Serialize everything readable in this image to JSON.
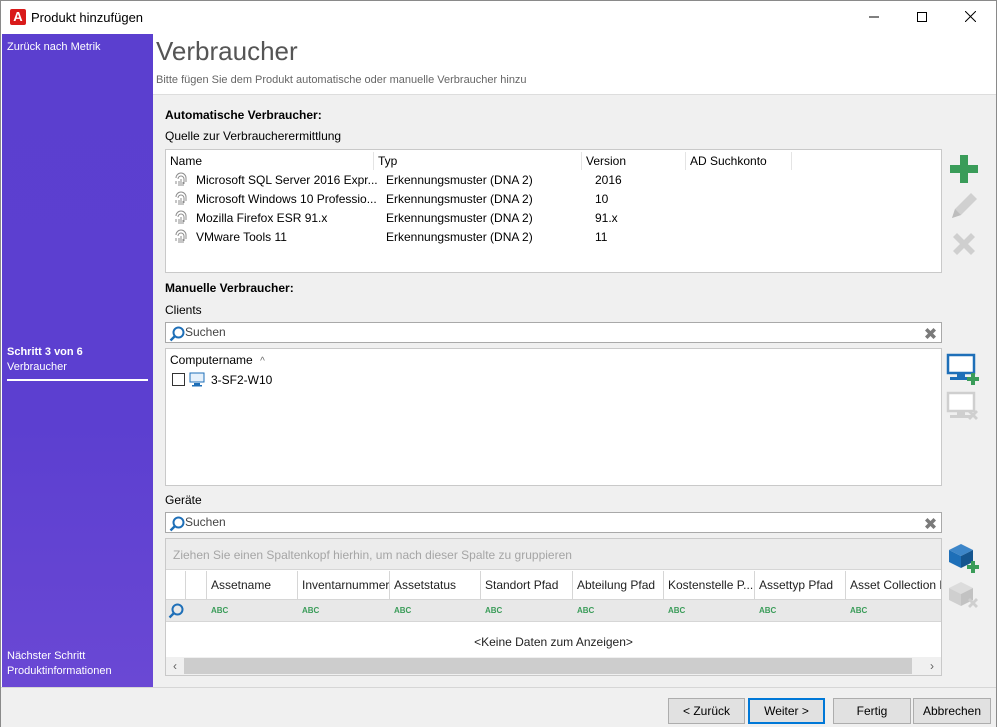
{
  "window": {
    "title": "Produkt hinzufügen",
    "app_icon_letter": "A"
  },
  "sidebar": {
    "back_link": "Zurück nach Metrik",
    "step_label": "Schritt 3 von 6",
    "step_name": "Verbraucher",
    "next_link": "Nächster Schritt Produktinformationen"
  },
  "header": {
    "title": "Verbraucher",
    "subtitle": "Bitte fügen Sie dem Produkt automatische oder manuelle Verbraucher hinzu"
  },
  "automatic": {
    "section_label": "Automatische Verbraucher:",
    "source_label": "Quelle zur Verbraucherermittlung",
    "columns": [
      "Name",
      "Typ",
      "Version",
      "AD Suchkonto"
    ],
    "rows": [
      {
        "name": "Microsoft SQL Server 2016 Expr...",
        "type": "Erkennungsmuster (DNA 2)",
        "version": "2016",
        "ad": ""
      },
      {
        "name": "Microsoft Windows 10 Professio...",
        "type": "Erkennungsmuster (DNA 2)",
        "version": "10",
        "ad": ""
      },
      {
        "name": "Mozilla Firefox ESR 91.x",
        "type": "Erkennungsmuster (DNA 2)",
        "version": "91.x",
        "ad": ""
      },
      {
        "name": "VMware Tools 11",
        "type": "Erkennungsmuster (DNA 2)",
        "version": "11",
        "ad": ""
      }
    ]
  },
  "manual": {
    "section_label": "Manuelle Verbraucher:",
    "clients_label": "Clients",
    "clients_search_placeholder": "Suchen",
    "computer_column": "Computername",
    "sort_indicator": "^",
    "clients": [
      {
        "name": "3-SF2-W10",
        "checked": false
      }
    ],
    "devices_label": "Geräte",
    "devices_search_placeholder": "Suchen",
    "group_panel_hint": "Ziehen Sie einen Spaltenkopf hierhin, um nach dieser Spalte zu gruppieren",
    "device_columns": [
      "Assetname",
      "Inventarnummer",
      "Assetstatus",
      "Standort Pfad",
      "Abteilung Pfad",
      "Kostenstelle P...",
      "Assettyp Pfad",
      "Asset Collection P"
    ],
    "filter_glyph": "ABC",
    "no_data": "<Keine Daten zum Anzeigen>"
  },
  "footer": {
    "back": "< Zurück",
    "next": "Weiter >",
    "finish": "Fertig",
    "cancel": "Abbrechen"
  },
  "colors": {
    "sidebar": "#5c3fd0",
    "accent_green": "#3a9c59",
    "icon_blue": "#1e6fb8",
    "primary_border": "#0078d7"
  }
}
